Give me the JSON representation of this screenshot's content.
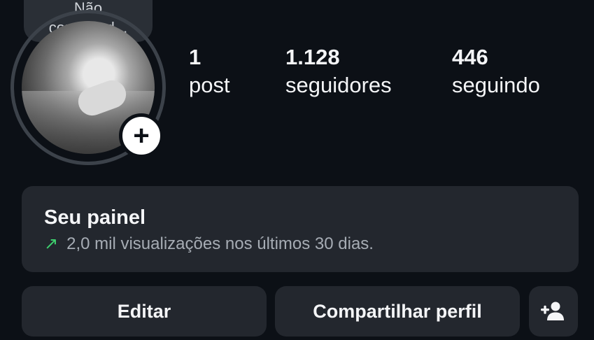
{
  "note": {
    "text_line1": "Não",
    "text_line2": "consigo d..."
  },
  "profile": {
    "add_glyph": "+"
  },
  "stats": [
    {
      "value": "1",
      "label": "post"
    },
    {
      "value": "1.128",
      "label": "seguidores"
    },
    {
      "value": "446",
      "label": "seguindo"
    }
  ],
  "panel": {
    "title": "Seu painel",
    "trend_icon": "↗",
    "subtitle": "2,0 mil visualizações nos últimos 30 dias."
  },
  "buttons": {
    "edit": "Editar",
    "share": "Compartilhar perfil"
  },
  "colors": {
    "background": "#0c1016",
    "card": "#23272e",
    "trend": "#3ecf6e"
  }
}
